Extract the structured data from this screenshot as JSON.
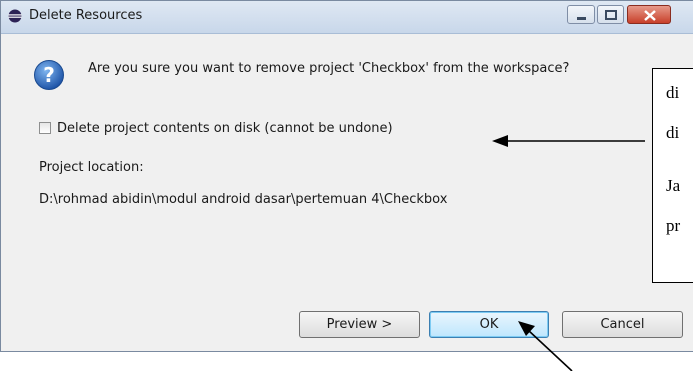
{
  "dialog": {
    "title": "Delete Resources",
    "question": "Are you sure you want to remove project 'Checkbox' from the workspace?",
    "checkbox_label": "Delete project contents on disk (cannot be undone)",
    "checkbox_checked": false,
    "location_label": "Project location:",
    "location_path": "D:\\rohmad abidin\\modul android dasar\\pertemuan 4\\Checkbox",
    "buttons": {
      "preview": "Preview >",
      "ok": "OK",
      "cancel": "Cancel"
    }
  },
  "annotation": {
    "lines": [
      "di",
      "di",
      "Ja",
      "pr"
    ]
  },
  "icons": {
    "title": "eclipse-icon",
    "question": "question-icon",
    "minimize": "minimize-icon",
    "maximize": "maximize-icon",
    "close": "close-icon"
  },
  "colors": {
    "accent": "#3c7fb1",
    "close": "#c8402a",
    "question_icon": "#2a63b6"
  }
}
